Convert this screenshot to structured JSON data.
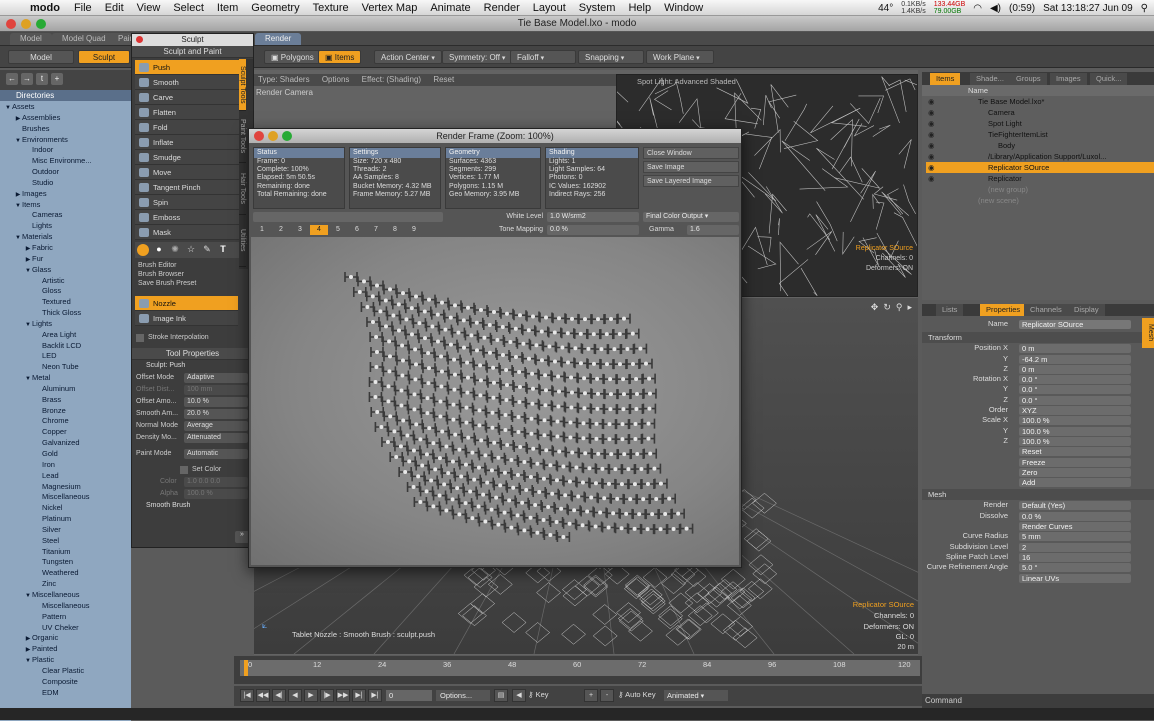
{
  "menubar": {
    "app": "modo",
    "items": [
      "File",
      "Edit",
      "View",
      "Select",
      "Item",
      "Geometry",
      "Texture",
      "Vertex Map",
      "Animate",
      "Render",
      "Layout",
      "System",
      "Help",
      "Window"
    ],
    "temp": "44°",
    "net1": "0.1KB/s",
    "net2": "1.4KB/s",
    "mem1": "133.44GB",
    "mem2": "79.00GB",
    "battery": "(0:59)",
    "clock": "Sat 13:18:27 Jun 09"
  },
  "window": {
    "title": "Tie Base Model.lxo - modo"
  },
  "tabs": [
    "Model",
    "Model Quad",
    "Paint",
    "Sculpt",
    "Render"
  ],
  "toolbar": {
    "polygons": "Polygons",
    "items": "Items",
    "action_center": "Action Center",
    "symmetry": "Symmetry: Off",
    "falloff": "Falloff",
    "snapping": "Snapping",
    "work_plane": "Work Plane"
  },
  "directories": {
    "header": "Directories",
    "rows": [
      {
        "label": "Assets",
        "level": 0,
        "open": true
      },
      {
        "label": "Assemblies",
        "level": 1,
        "open": false
      },
      {
        "label": "Brushes",
        "level": 1,
        "open": null
      },
      {
        "label": "Environments",
        "level": 1,
        "open": true
      },
      {
        "label": "Indoor",
        "level": 2,
        "open": null
      },
      {
        "label": "Misc Environme...",
        "level": 2,
        "open": null
      },
      {
        "label": "Outdoor",
        "level": 2,
        "open": null
      },
      {
        "label": "Studio",
        "level": 2,
        "open": null
      },
      {
        "label": "Images",
        "level": 1,
        "open": false
      },
      {
        "label": "Items",
        "level": 1,
        "open": true
      },
      {
        "label": "Cameras",
        "level": 2,
        "open": null
      },
      {
        "label": "Lights",
        "level": 2,
        "open": null
      },
      {
        "label": "Materials",
        "level": 1,
        "open": true
      },
      {
        "label": "Fabric",
        "level": 2,
        "open": false
      },
      {
        "label": "Fur",
        "level": 2,
        "open": false
      },
      {
        "label": "Glass",
        "level": 2,
        "open": true
      },
      {
        "label": "Artistic",
        "level": 3,
        "open": null
      },
      {
        "label": "Gloss",
        "level": 3,
        "open": null
      },
      {
        "label": "Textured",
        "level": 3,
        "open": null
      },
      {
        "label": "Thick Gloss",
        "level": 3,
        "open": null
      },
      {
        "label": "Lights",
        "level": 2,
        "open": true
      },
      {
        "label": "Area Light",
        "level": 3,
        "open": null
      },
      {
        "label": "Backlit LCD",
        "level": 3,
        "open": null
      },
      {
        "label": "LED",
        "level": 3,
        "open": null
      },
      {
        "label": "Neon Tube",
        "level": 3,
        "open": null
      },
      {
        "label": "Metal",
        "level": 2,
        "open": true
      },
      {
        "label": "Aluminum",
        "level": 3,
        "open": null
      },
      {
        "label": "Brass",
        "level": 3,
        "open": null
      },
      {
        "label": "Bronze",
        "level": 3,
        "open": null
      },
      {
        "label": "Chrome",
        "level": 3,
        "open": null
      },
      {
        "label": "Copper",
        "level": 3,
        "open": null
      },
      {
        "label": "Galvanized",
        "level": 3,
        "open": null
      },
      {
        "label": "Gold",
        "level": 3,
        "open": null
      },
      {
        "label": "Iron",
        "level": 3,
        "open": null
      },
      {
        "label": "Lead",
        "level": 3,
        "open": null
      },
      {
        "label": "Magnesium",
        "level": 3,
        "open": null
      },
      {
        "label": "Miscellaneous",
        "level": 3,
        "open": null
      },
      {
        "label": "Nickel",
        "level": 3,
        "open": null
      },
      {
        "label": "Platinum",
        "level": 3,
        "open": null
      },
      {
        "label": "Silver",
        "level": 3,
        "open": null
      },
      {
        "label": "Steel",
        "level": 3,
        "open": null
      },
      {
        "label": "Titanium",
        "level": 3,
        "open": null
      },
      {
        "label": "Tungsten",
        "level": 3,
        "open": null
      },
      {
        "label": "Weathered",
        "level": 3,
        "open": null
      },
      {
        "label": "Zinc",
        "level": 3,
        "open": null
      },
      {
        "label": "Miscellaneous",
        "level": 2,
        "open": true
      },
      {
        "label": "Miscellaneous",
        "level": 3,
        "open": null
      },
      {
        "label": "Pattern",
        "level": 3,
        "open": null
      },
      {
        "label": "UV Cheker",
        "level": 3,
        "open": null
      },
      {
        "label": "Organic",
        "level": 2,
        "open": false
      },
      {
        "label": "Painted",
        "level": 2,
        "open": false
      },
      {
        "label": "Plastic",
        "level": 2,
        "open": true
      },
      {
        "label": "Clear Plastic",
        "level": 3,
        "open": null
      },
      {
        "label": "Composite",
        "level": 3,
        "open": null
      },
      {
        "label": "EDM",
        "level": 3,
        "open": null
      }
    ]
  },
  "sculpt": {
    "title": "Sculpt",
    "section": "Sculpt and Paint",
    "tools": [
      "Push",
      "Smooth",
      "Carve",
      "Flatten",
      "Fold",
      "Inflate",
      "Smudge",
      "Move",
      "Tangent Pinch",
      "Spin",
      "Emboss",
      "Mask"
    ],
    "vtabs": [
      "Sculpt Tools",
      "Paint Tools",
      "Hair Tools",
      "Utilities"
    ],
    "brush_editor": "Brush Editor",
    "brush_browser": "Brush Browser",
    "save_brush_preset": "Save Brush Preset",
    "nozzle": "Nozzle",
    "image_ink": "Image Ink",
    "stroke_interpolation": "Stroke Interpolation",
    "tool_properties": "Tool Properties",
    "sculpt_push": "Sculpt: Push",
    "props": [
      {
        "label": "Offset Mode",
        "value": "Adaptive",
        "dim": false
      },
      {
        "label": "Offset Dist...",
        "value": "100 mm",
        "dim": true
      },
      {
        "label": "Offset Amo...",
        "value": "10.0 %",
        "dim": false
      },
      {
        "label": "Smooth Am...",
        "value": "20.0 %",
        "dim": false
      },
      {
        "label": "Normal Mode",
        "value": "Average",
        "dim": false
      },
      {
        "label": "Density Mo...",
        "value": "Attenuated",
        "dim": false
      }
    ],
    "paint_mode_label": "Paint Mode",
    "paint_mode": "Automatic",
    "set_color": "Set Color",
    "color_label": "Color",
    "color_value": "1.0  0.0  0.0",
    "alpha_label": "Alpha",
    "alpha_value": "100.0 %",
    "smooth_brush": "Smooth Brush"
  },
  "viewport": {
    "header": [
      "Type: Shaders",
      "Options",
      "Effect: (Shading)",
      "Reset"
    ],
    "render_camera": "Render Camera",
    "spot_light_label": "Spot Light: Advanced Shaded",
    "hud_left": "Tablet Nozzle : Smooth Brush : sculpt.push",
    "hud_item": "Replicator SOurce",
    "hud_channels": "Channels: 0",
    "hud_deformers": "Deformers: ON",
    "hud_gl": "GL: 0",
    "hud_dist": "20 m",
    "top_item": "Replicator SOurce",
    "top_channels": "Channels: 0",
    "top_deformers": "Deformers: ON"
  },
  "render_frame": {
    "title": "Render Frame (Zoom: 100%)",
    "status": {
      "header": "Status",
      "lines": [
        "Frame: 0",
        "Complete: 100%",
        "Elapsed: 5m 50.5s",
        "Remaining: done",
        "Total Remaining: done"
      ]
    },
    "settings": {
      "header": "Settings",
      "lines": [
        "Size: 720 x 480",
        "Threads: 2",
        "AA Samples: 8",
        "Bucket Memory: 4.32 MB",
        "Frame Memory: 5.27 MB"
      ]
    },
    "geometry": {
      "header": "Geometry",
      "lines": [
        "Surfaces: 4363",
        "Segments: 299",
        "Vertices: 1.77 M",
        "Polygons: 1.15 M",
        "Geo Memory: 3.95 MB"
      ]
    },
    "shading": {
      "header": "Shading",
      "lines": [
        "Lights: 1",
        "Light Samples: 64",
        "Photons: 0",
        "IC Values: 162902",
        "Indirect Rays: 256"
      ]
    },
    "buttons": [
      "Close Window",
      "Save Image",
      "Save Layered Image"
    ],
    "white_level_label": "White Level",
    "white_level": "1.0 W/srm2",
    "tone_mapping_label": "Tone Mapping",
    "tone_mapping": "0.0 %",
    "final_color": "Final Color Output",
    "gamma_label": "Gamma",
    "gamma": "1.6",
    "frames": [
      "1",
      "2",
      "3",
      "4",
      "5",
      "6",
      "7",
      "8",
      "9"
    ],
    "active_frame": "4"
  },
  "items_panel": {
    "tabs": [
      "Items",
      "Shade...",
      "Groups",
      "Images",
      "Quick..."
    ],
    "name_header": "Name",
    "rows": [
      {
        "label": "Tie Base Model.lxo*",
        "indent": 0,
        "sel": false
      },
      {
        "label": "Camera",
        "indent": 1,
        "sel": false
      },
      {
        "label": "Spot Light",
        "indent": 1,
        "sel": false
      },
      {
        "label": "TieFighterItemList",
        "indent": 1,
        "sel": false
      },
      {
        "label": "Body",
        "indent": 2,
        "sel": false
      },
      {
        "label": "/Library/Application Support/Luxol...",
        "indent": 1,
        "sel": false
      },
      {
        "label": "Replicator SOurce",
        "indent": 1,
        "sel": true
      },
      {
        "label": "Replicator",
        "indent": 1,
        "sel": false
      },
      {
        "label": "(new group)",
        "indent": 1,
        "sel": false
      },
      {
        "label": "(new scene)",
        "indent": 0,
        "sel": false
      }
    ]
  },
  "properties": {
    "tabs": [
      "Lists",
      "Properties",
      "Channels",
      "Display"
    ],
    "vtab": "Mesh",
    "name_label": "Name",
    "name_value": "Replicator SOurce",
    "transform": "Transform",
    "rows": [
      {
        "label": "Position X",
        "value": "0 m"
      },
      {
        "label": "Y",
        "value": "-64.2 m"
      },
      {
        "label": "Z",
        "value": "0 m"
      },
      {
        "label": "Rotation X",
        "value": "0.0 °"
      },
      {
        "label": "Y",
        "value": "0.0 °"
      },
      {
        "label": "Z",
        "value": "0.0 °"
      },
      {
        "label": "Order",
        "value": "XYZ"
      },
      {
        "label": "Scale X",
        "value": "100.0 %"
      },
      {
        "label": "Y",
        "value": "100.0 %"
      },
      {
        "label": "Z",
        "value": "100.0 %"
      },
      {
        "label": "",
        "value": "Reset"
      },
      {
        "label": "",
        "value": "Freeze"
      },
      {
        "label": "",
        "value": "Zero"
      },
      {
        "label": "",
        "value": "Add"
      }
    ],
    "mesh": "Mesh",
    "mesh_rows": [
      {
        "label": "Render",
        "value": "Default (Yes)"
      },
      {
        "label": "Dissolve",
        "value": "0.0 %"
      },
      {
        "label": "",
        "value": "Render Curves"
      },
      {
        "label": "Curve Radius",
        "value": "5 mm"
      },
      {
        "label": "Subdivision Level",
        "value": "2"
      },
      {
        "label": "Spline Patch Level",
        "value": "16"
      },
      {
        "label": "Curve Refinement Angle",
        "value": "5.0 °"
      },
      {
        "label": "",
        "value": "Linear UVs"
      }
    ]
  },
  "timeline": {
    "ticks": [
      "0",
      "12",
      "24",
      "36",
      "48",
      "60",
      "72",
      "84",
      "96",
      "108",
      "120"
    ],
    "frame_value": "0",
    "options": "Options...",
    "key": "Key",
    "auto_key": "Auto Key",
    "animated": "Animated"
  },
  "command": {
    "label": "Command"
  }
}
